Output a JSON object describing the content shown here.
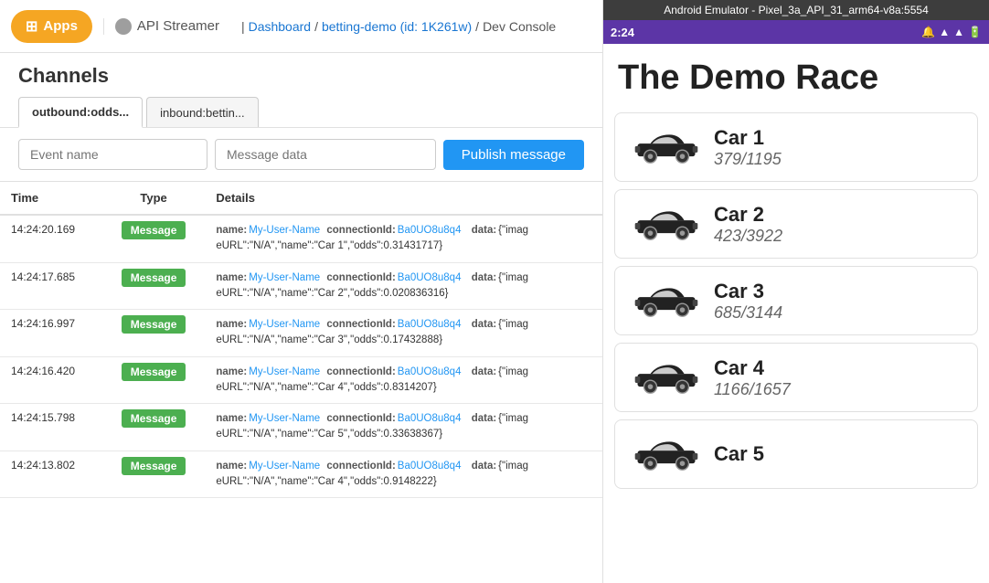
{
  "nav": {
    "apps_label": "Apps",
    "api_streamer_label": "API Streamer",
    "breadcrumb": {
      "dashboard": "Dashboard",
      "betting_demo": "betting-demo (id: 1K261w)",
      "dev_console": "Dev Console"
    }
  },
  "channels": {
    "header": "Channels",
    "tabs": [
      {
        "label": "outbound:odds...",
        "active": true
      },
      {
        "label": "inbound:bettin...",
        "active": false
      }
    ]
  },
  "message_bar": {
    "event_name_placeholder": "Event name",
    "message_data_placeholder": "Message data",
    "publish_label": "Publish message"
  },
  "table": {
    "headers": [
      "Time",
      "Type",
      "Details"
    ],
    "rows": [
      {
        "time": "14:24:20.169",
        "type": "Message",
        "name_key": "name:",
        "name_val": "My-User-Name",
        "conn_key": "connectionId:",
        "conn_val": "Ba0UO8u8q4",
        "data_key": "data:",
        "data_val": "{\"imag",
        "detail2": "eURL\":\"N/A\",\"name\":\"Car 1\",\"odds\":0.31431717}"
      },
      {
        "time": "14:24:17.685",
        "type": "Message",
        "name_key": "name:",
        "name_val": "My-User-Name",
        "conn_key": "connectionId:",
        "conn_val": "Ba0UO8u8q4",
        "data_key": "data:",
        "data_val": "{\"imag",
        "detail2": "eURL\":\"N/A\",\"name\":\"Car 2\",\"odds\":0.020836316}"
      },
      {
        "time": "14:24:16.997",
        "type": "Message",
        "name_key": "name:",
        "name_val": "My-User-Name",
        "conn_key": "connectionId:",
        "conn_val": "Ba0UO8u8q4",
        "data_key": "data:",
        "data_val": "{\"imag",
        "detail2": "eURL\":\"N/A\",\"name\":\"Car 3\",\"odds\":0.17432888}"
      },
      {
        "time": "14:24:16.420",
        "type": "Message",
        "name_key": "name:",
        "name_val": "My-User-Name",
        "conn_key": "connectionId:",
        "conn_val": "Ba0UO8u8q4",
        "data_key": "data:",
        "data_val": "{\"imag",
        "detail2": "eURL\":\"N/A\",\"name\":\"Car 4\",\"odds\":0.8314207}"
      },
      {
        "time": "14:24:15.798",
        "type": "Message",
        "name_key": "name:",
        "name_val": "My-User-Name",
        "conn_key": "connectionId:",
        "conn_val": "Ba0UO8u8q4",
        "data_key": "data:",
        "data_val": "{\"imag",
        "detail2": "eURL\":\"N/A\",\"name\":\"Car 5\",\"odds\":0.33638367}"
      },
      {
        "time": "14:24:13.802",
        "type": "Message",
        "name_key": "name:",
        "name_val": "My-User-Name",
        "conn_key": "connectionId:",
        "conn_val": "Ba0UO8u8q4",
        "data_key": "data:",
        "data_val": "{\"imag",
        "detail2": "eURL\":\"N/A\",\"name\":\"Car 4\",\"odds\":0.9148222}"
      }
    ]
  },
  "emulator": {
    "title_bar": "Android Emulator - Pixel_3a_API_31_arm64-v8a:5554",
    "time": "2:24",
    "race_title": "The Demo Race",
    "cars": [
      {
        "name": "Car 1",
        "odds": "379/1195"
      },
      {
        "name": "Car 2",
        "odds": "423/3922"
      },
      {
        "name": "Car 3",
        "odds": "685/3144"
      },
      {
        "name": "Car 4",
        "odds": "1166/1657"
      },
      {
        "name": "Car 5",
        "odds": ""
      }
    ]
  },
  "colors": {
    "apps_bg": "#f5a623",
    "publish_bg": "#2196f3",
    "type_badge_bg": "#4caf50",
    "emulator_status_bg": "#5c35a6"
  }
}
